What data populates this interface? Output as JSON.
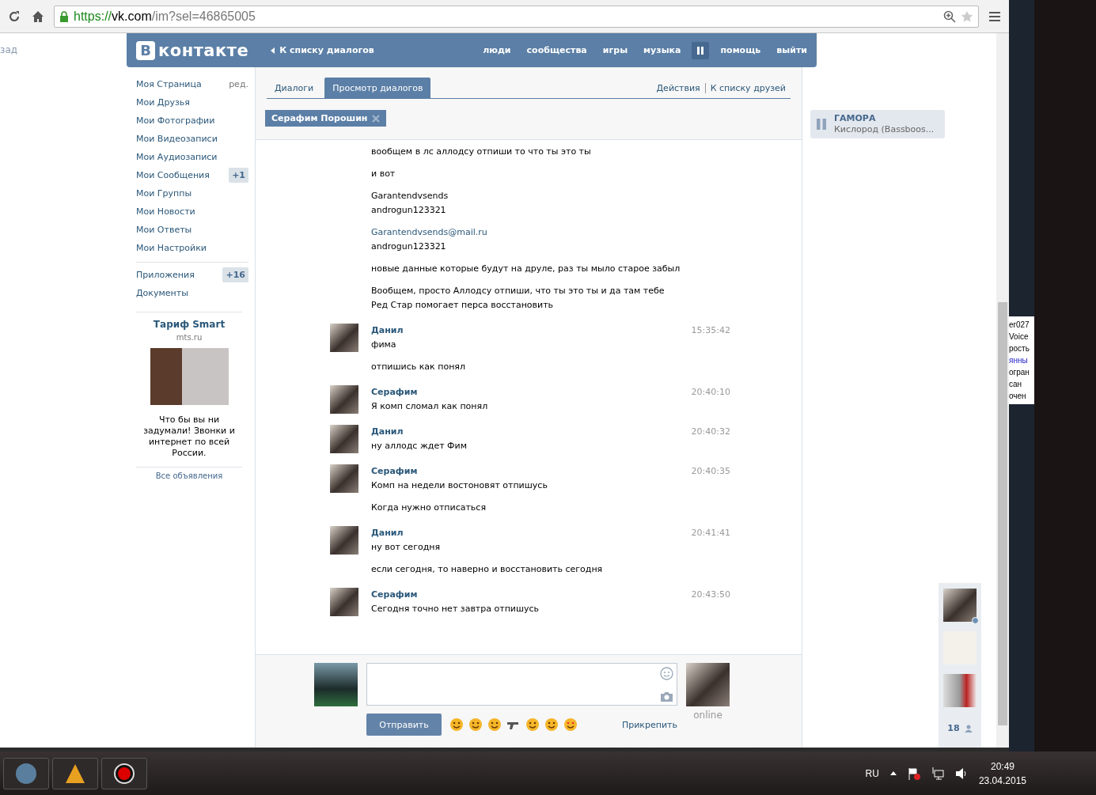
{
  "browser": {
    "url_scheme": "https://",
    "url_host": "vk.com",
    "url_path": "/im?sel=46865005"
  },
  "back_fragment": "зад",
  "header": {
    "logo_letter": "В",
    "logo_text": "контакте",
    "back_link": "К списку диалогов",
    "playing": true,
    "nav": [
      {
        "label": "люди"
      },
      {
        "label": "сообщества"
      },
      {
        "label": "игры"
      },
      {
        "label": "музыка"
      },
      {
        "label": "помощь"
      },
      {
        "label": "выйти"
      }
    ]
  },
  "sidebar": {
    "items": [
      {
        "label": "Моя Страница",
        "extra": "ред."
      },
      {
        "label": "Мои Друзья"
      },
      {
        "label": "Мои Фотографии"
      },
      {
        "label": "Мои Видеозаписи"
      },
      {
        "label": "Мои Аудиозаписи"
      },
      {
        "label": "Мои Сообщения",
        "count": "+1"
      },
      {
        "label": "Мои Группы"
      },
      {
        "label": "Мои Новости"
      },
      {
        "label": "Мои Ответы"
      },
      {
        "label": "Мои Настройки"
      }
    ],
    "more_items": [
      {
        "label": "Приложения",
        "count": "+16"
      },
      {
        "label": "Документы"
      }
    ],
    "ad": {
      "title": "Тариф Smart",
      "domain": "mts.ru",
      "text": "Что бы вы ни задумали! Звонки и интернет по всей России.",
      "all_link": "Все объявления"
    }
  },
  "tabs": [
    {
      "label": "Диалоги",
      "selected": false
    },
    {
      "label": "Просмотр диалогов",
      "selected": true
    }
  ],
  "actions": [
    "Действия",
    "К списку друзей"
  ],
  "chip": "Серафим Порошин",
  "messages": [
    {
      "kind": "continuation",
      "lines": [
        {
          "text": "вообщем в лс аллодсу отпиши то что ты это ты",
          "link": false
        }
      ]
    },
    {
      "kind": "continuation",
      "lines": [
        {
          "text": "и вот",
          "link": false
        }
      ]
    },
    {
      "kind": "continuation",
      "lines": [
        {
          "text": "Garantendvsends",
          "link": false
        },
        {
          "text": "androgun123321",
          "link": false
        }
      ]
    },
    {
      "kind": "continuation",
      "lines": [
        {
          "text": "Garantendvsends@mail.ru",
          "link": true
        },
        {
          "text": "androgun123321",
          "link": false
        }
      ]
    },
    {
      "kind": "continuation",
      "lines": [
        {
          "text": "новые данные которые будут на друле, раз ты мыло старое забыл",
          "link": false
        }
      ]
    },
    {
      "kind": "continuation",
      "lines": [
        {
          "text": "Вообщем, просто Аллодсу отпиши, что ты это ты и да там тебе",
          "link": false
        },
        {
          "text": "Ред Стар помогает перса восстановить",
          "link": false
        }
      ]
    },
    {
      "kind": "header",
      "author": "Данил",
      "time": "15:35:42",
      "lines": [
        {
          "text": "фима",
          "link": false
        }
      ]
    },
    {
      "kind": "continuation",
      "lines": [
        {
          "text": "отпишись как понял",
          "link": false
        }
      ]
    },
    {
      "kind": "header",
      "author": "Серафим",
      "time": "20:40:10",
      "lines": [
        {
          "text": "Я комп сломал как понял",
          "link": false
        }
      ]
    },
    {
      "kind": "header",
      "author": "Данил",
      "time": "20:40:32",
      "lines": [
        {
          "text": "ну аллодс ждет Фим",
          "link": false
        }
      ]
    },
    {
      "kind": "header",
      "author": "Серафим",
      "time": "20:40:35",
      "lines": [
        {
          "text": "Комп на недели востоновят отпишусь",
          "link": false
        }
      ]
    },
    {
      "kind": "continuation",
      "lines": [
        {
          "text": "Когда нужно отписаться",
          "link": false
        }
      ]
    },
    {
      "kind": "header",
      "author": "Данил",
      "time": "20:41:41",
      "lines": [
        {
          "text": "ну вот сегодня",
          "link": false
        }
      ]
    },
    {
      "kind": "continuation",
      "lines": [
        {
          "text": "если сегодня, то наверно и восстановить сегодня",
          "link": false
        }
      ]
    },
    {
      "kind": "header",
      "author": "Серафим",
      "time": "20:43:50",
      "lines": [
        {
          "text": "Сегодня точно нет завтра отпишусь",
          "link": false
        }
      ]
    }
  ],
  "compose": {
    "send": "Отправить",
    "attach": "Прикрепить",
    "status": "online"
  },
  "player": {
    "artist": "ГАМОРА",
    "track": "Кислород (Bassboos...",
    "playing": true
  },
  "dock": {
    "count": "18"
  },
  "background_window": {
    "lines": [
      {
        "text": "er027",
        "link": false
      },
      {
        "text": "Voice",
        "link": false
      },
      {
        "text": "рость",
        "link": false
      },
      {
        "text": "янны",
        "link": true
      },
      {
        "text": "огран",
        "link": false
      },
      {
        "text": "сан",
        "link": false
      },
      {
        "text": "очен",
        "link": false
      }
    ]
  },
  "taskbar": {
    "lang": "RU",
    "time": "20:49",
    "date": "23.04.2015"
  }
}
